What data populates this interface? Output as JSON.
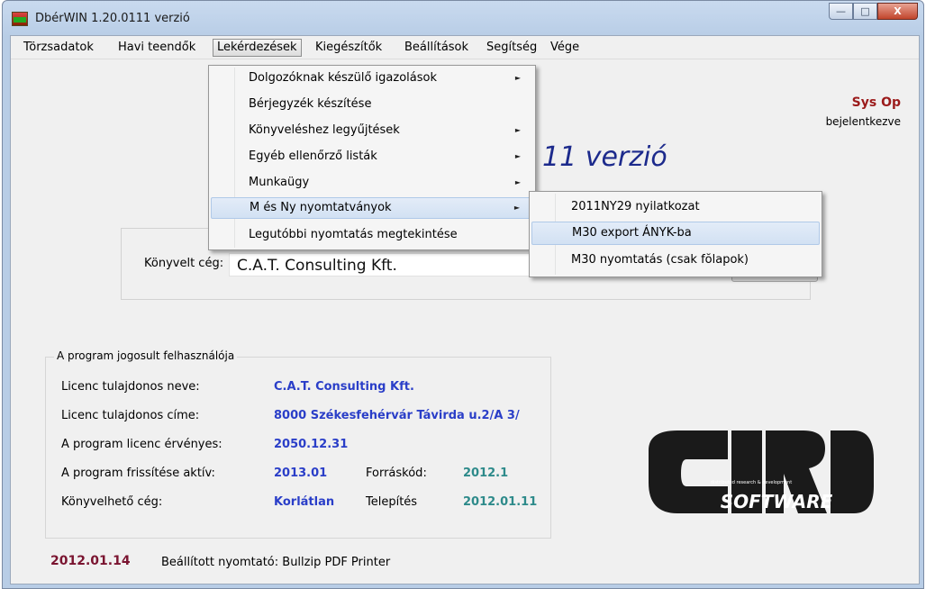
{
  "window": {
    "title": "DbérWIN 1.20.0111 verzió",
    "controls": {
      "minimize": "—",
      "maximize": "□",
      "close": "X"
    }
  },
  "menubar": {
    "items": [
      {
        "label": "Törzsadatok"
      },
      {
        "label": "Havi teendők"
      },
      {
        "label": "Lekérdezések"
      },
      {
        "label": "Kiegészítők"
      },
      {
        "label": "Beállítások"
      },
      {
        "label": "Segítség"
      },
      {
        "label": "Vége"
      }
    ],
    "active": "Lekérdezések"
  },
  "dropdown": {
    "items": [
      {
        "label": "Dolgozóknak készülő igazolások",
        "submenu": true
      },
      {
        "label": "Bérjegyzék készítése",
        "submenu": false
      },
      {
        "label": "Könyveléshez legyűjtések",
        "submenu": true
      },
      {
        "label": "Egyéb ellenőrző listák",
        "submenu": true
      },
      {
        "label": "Munkaügy",
        "submenu": true
      },
      {
        "label": "M és Ny nyomtatványok",
        "submenu": true
      },
      {
        "label": "Legutóbbi nyomtatás megtekintése",
        "submenu": false
      }
    ],
    "arrow": "►",
    "highlighted": "M és Ny nyomtatványok"
  },
  "submenu": {
    "items": [
      {
        "label": "2011NY29 nyilatkozat"
      },
      {
        "label": "M30 export ÁNYK-ba"
      },
      {
        "label": "M30 nyomtatás (csak fŏlapok)"
      }
    ],
    "highlighted": "M30 export ÁNYK-ba"
  },
  "user": {
    "name": "Sys Op",
    "status": "bejelentkezve"
  },
  "version_text": "11 verzió",
  "company": {
    "label": "Könyvelt cég:",
    "value": "C.A.T. Consulting Kft."
  },
  "licence": {
    "title": "A program jogosult felhasználója",
    "rows": [
      {
        "label": "Licenc tulajdonos neve:",
        "value": "C.A.T. Consulting Kft."
      },
      {
        "label": "Licenc tulajdonos címe:",
        "value": "8000 Székesfehérvár Távirda u.2/A 3/"
      },
      {
        "label": "A program licenc érvényes:",
        "value": "2050.12.31"
      },
      {
        "label": "A program frissítése aktív:",
        "value": "2013.01",
        "label2": "Forráskód:",
        "value2": "2012.1"
      },
      {
        "label": "Könyvelhető cég:",
        "value": "Korlátlan",
        "label2": "Telepítés",
        "value2": "2012.01.11"
      }
    ]
  },
  "logo": {
    "text": "SOFTWARE",
    "tagline": "distributed research & development"
  },
  "statusbar": {
    "date": "2012.01.14",
    "printer": "Beállított nyomtató: Bullzip PDF Printer"
  },
  "colors": {
    "title_accent": "#1c2a8c",
    "user_name": "#9b1b1b",
    "licence_value": "#2a3ec8",
    "licence_value_alt": "#2d8a8a",
    "status_date": "#7a1430"
  }
}
